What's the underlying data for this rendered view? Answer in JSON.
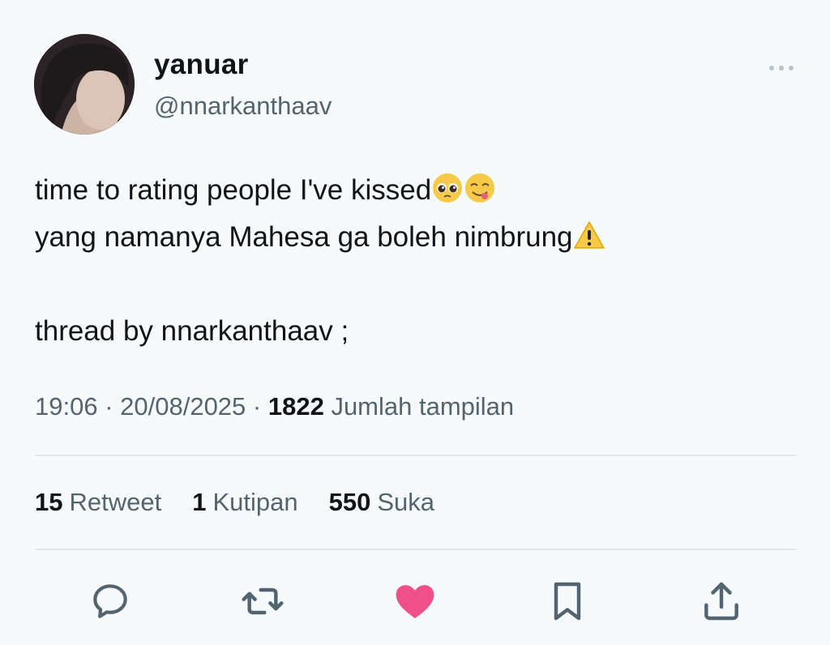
{
  "user": {
    "display_name": "yanuar",
    "handle": "@nnarkanthaav"
  },
  "tweet": {
    "line1": "time to rating people I've kissed",
    "line2": "yang namanya Mahesa ga boleh nimbrung",
    "line3": "thread by nnarkanthaav ;"
  },
  "meta": {
    "time": "19:06",
    "separator": " · ",
    "date": "20/08/2025",
    "views_count": "1822",
    "views_label": " Jumlah tampilan"
  },
  "stats": [
    {
      "count": "15",
      "label": "Retweet"
    },
    {
      "count": "1",
      "label": "Kutipan"
    },
    {
      "count": "550",
      "label": "Suka"
    }
  ],
  "icons": {
    "reply": "reply-icon",
    "retweet": "retweet-icon",
    "like": "heart-icon",
    "bookmark": "bookmark-icon",
    "share": "share-icon",
    "more": "more-icon"
  },
  "colors": {
    "like_active": "#f0508a",
    "icon": "#536471"
  }
}
